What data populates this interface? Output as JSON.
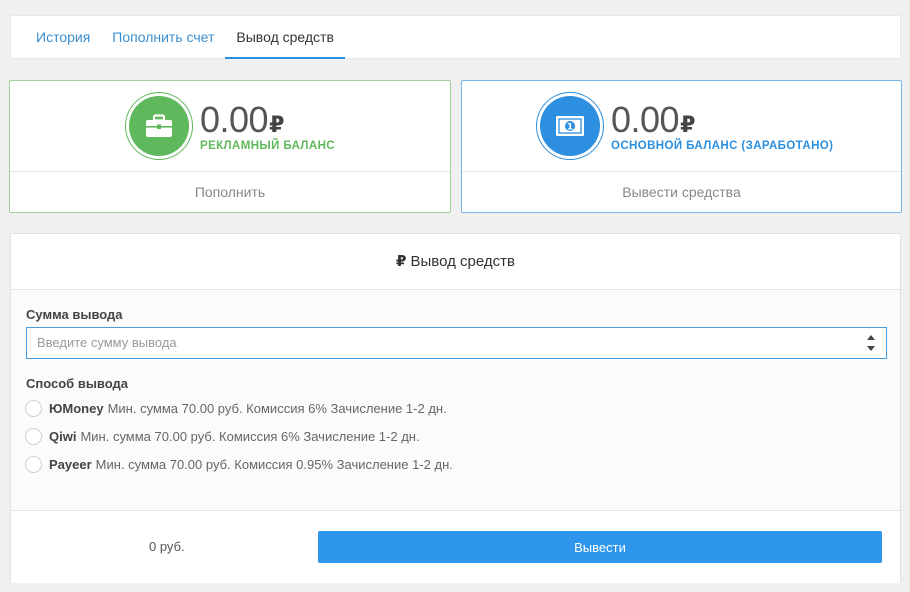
{
  "tabs": [
    {
      "label": "История",
      "active": false
    },
    {
      "label": "Пополнить счет",
      "active": false
    },
    {
      "label": "Вывод средств",
      "active": true
    }
  ],
  "ad_balance": {
    "amount": "0.00",
    "currency": "₽",
    "label": "РЕКЛАМНЫЙ БАЛАНС",
    "action": "Пополнить",
    "icon": "briefcase-icon",
    "color": "#5fb85b"
  },
  "main_balance": {
    "amount": "0.00",
    "currency": "₽",
    "label": "ОСНОВНОЙ БАЛАНС (ЗАРАБОТАНО)",
    "action": "Вывести средства",
    "icon": "banknote-icon",
    "color": "#2d8fe0"
  },
  "withdraw": {
    "title_symbol": "₽",
    "title": "Вывод средств",
    "amount_label": "Сумма вывода",
    "amount_placeholder": "Введите сумму вывода",
    "method_label": "Способ вывода",
    "methods": [
      {
        "name": "ЮMoney",
        "details": "Мин. сумма 70.00 руб. Комиссия 6% Зачисление 1-2 дн."
      },
      {
        "name": "Qiwi",
        "details": "Мин. сумма 70.00 руб. Комиссия 6% Зачисление 1-2 дн."
      },
      {
        "name": "Payeer",
        "details": "Мин. сумма 70.00 руб. Комиссия 0.95% Зачисление 1-2 дн."
      }
    ],
    "total": "0 руб.",
    "submit_label": "Вывести"
  }
}
